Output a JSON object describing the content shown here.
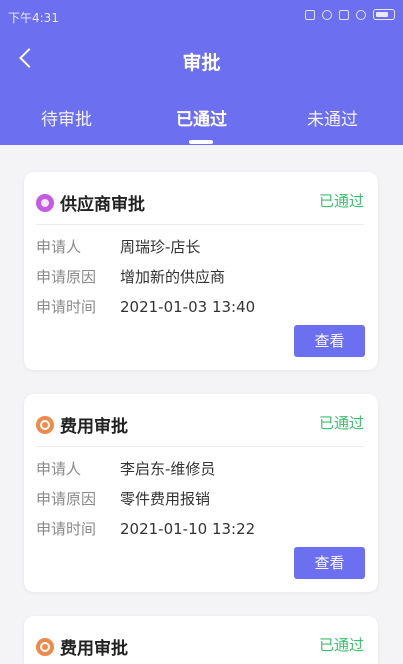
{
  "status_bar": {
    "time": "下午4:31"
  },
  "header": {
    "title": "审批"
  },
  "tabs": [
    {
      "label": "待审批"
    },
    {
      "label": "已通过"
    },
    {
      "label": "未通过"
    }
  ],
  "cards": [
    {
      "icon": "supplier-icon",
      "title": "供应商审批",
      "status": "已通过",
      "rows": [
        {
          "label": "申请人",
          "value": "周瑞珍-店长"
        },
        {
          "label": "申请原因",
          "value": "增加新的供应商"
        },
        {
          "label": "申请时间",
          "value": "2021-01-03 13:40"
        }
      ],
      "button": "查看"
    },
    {
      "icon": "expense-icon",
      "title": "费用审批",
      "status": "已通过",
      "rows": [
        {
          "label": "申请人",
          "value": "李启东-维修员"
        },
        {
          "label": "申请原因",
          "value": "零件费用报销"
        },
        {
          "label": "申请时间",
          "value": "2021-01-10 13:22"
        }
      ],
      "button": "查看"
    },
    {
      "icon": "expense-icon",
      "title": "费用审批",
      "status": "已通过"
    }
  ],
  "colors": {
    "primary": "#6c6ff0",
    "approved": "#3cbf6f"
  }
}
